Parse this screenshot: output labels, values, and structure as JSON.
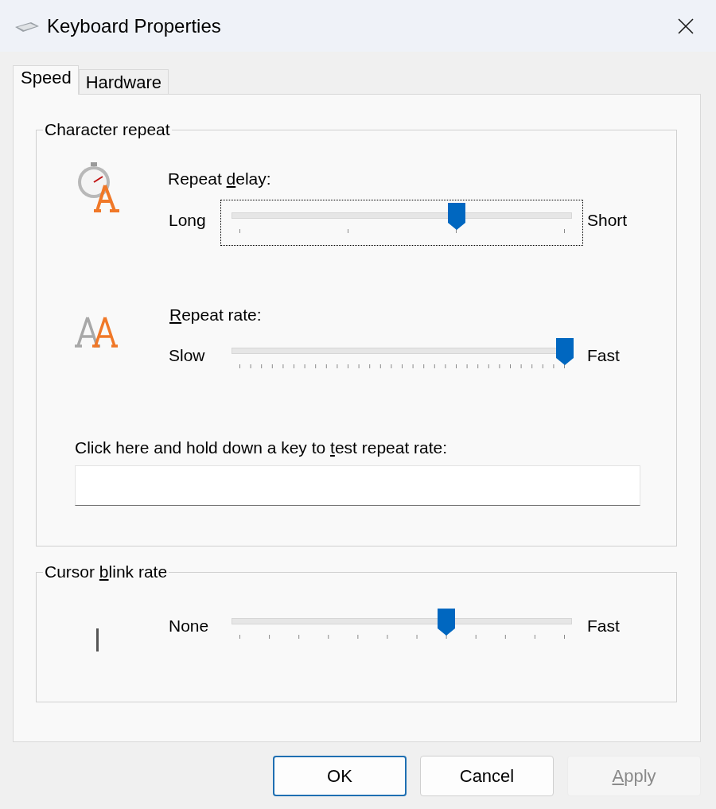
{
  "window": {
    "title": "Keyboard Properties"
  },
  "tabs": [
    {
      "label": "Speed",
      "selected": true
    },
    {
      "label": "Hardware",
      "selected": false
    }
  ],
  "character_repeat": {
    "title": "Character repeat",
    "delay": {
      "label": [
        {
          "text": "Repeat ",
          "underline": false
        },
        {
          "text": "d",
          "underline": true
        },
        {
          "text": "elay:",
          "underline": false
        }
      ],
      "min_label": "Long",
      "max_label": "Short",
      "level": 0.667,
      "focused": true
    },
    "rate": {
      "label": [
        {
          "text": "R",
          "underline": true
        },
        {
          "text": "epeat rate:",
          "underline": false
        }
      ],
      "min_label": "Slow",
      "max_label": "Fast",
      "level": 1,
      "focused": false
    },
    "test": {
      "label": [
        {
          "text": "Click here and hold down a key to ",
          "underline": false
        },
        {
          "text": "t",
          "underline": true
        },
        {
          "text": "est repeat rate:",
          "underline": false
        }
      ]
    }
  },
  "cursor_blink": {
    "title": [
      {
        "text": "Cursor ",
        "underline": false
      },
      {
        "text": "b",
        "underline": true
      },
      {
        "text": "link rate",
        "underline": false
      }
    ],
    "min_label": "None",
    "max_label": "Fast",
    "level": 0.636,
    "focused": false
  },
  "buttons": [
    {
      "label": [
        {
          "text": "OK",
          "underline": false
        }
      ],
      "default": true,
      "disabled": false
    },
    {
      "label": [
        {
          "text": "Cancel",
          "underline": false
        }
      ],
      "default": false,
      "disabled": false
    },
    {
      "label": [
        {
          "text": "A",
          "underline": true
        },
        {
          "text": "pply",
          "underline": false
        }
      ],
      "default": false,
      "disabled": true
    }
  ]
}
